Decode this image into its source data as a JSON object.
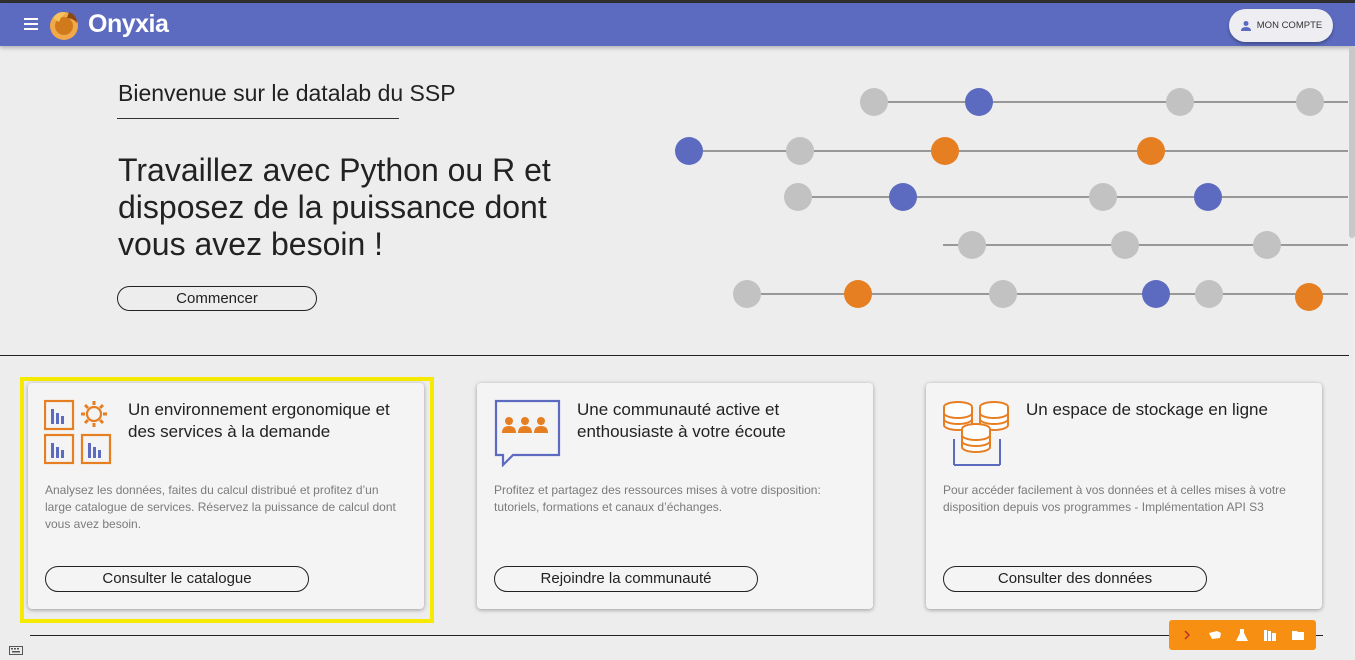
{
  "app": {
    "brand": "Onyxia",
    "account_label": "MON COMPTE"
  },
  "hero": {
    "subtitle": "Bienvenue sur le datalab du SSP",
    "title": "Travaillez avec Python ou R et disposez de la puissance dont vous avez besoin !",
    "cta": "Commencer"
  },
  "cards": [
    {
      "title": "Un environnement ergonomique et des services à la demande",
      "description": "Analysez les données, faites du calcul distribué et profitez d’un large catalogue de services. Réservez la puissance de calcul dont vous avez besoin.",
      "button": "Consulter le catalogue",
      "icon": "services-icon"
    },
    {
      "title": "Une communauté active et enthousiaste à votre écoute",
      "description": "Profitez et partagez des ressources mises à votre disposition: tutoriels, formations et canaux d’échanges.",
      "button": "Rejoindre la communauté",
      "icon": "community-icon"
    },
    {
      "title": "Un espace de stockage en ligne",
      "description": "Pour accéder facilement à vos données et à celles mises à votre disposition depuis vos programmes - Implémentation API S3",
      "button": "Consulter des données",
      "icon": "storage-icon"
    }
  ],
  "toolbar": {
    "items": [
      "chevron-right-icon",
      "tools-icon",
      "flask-icon",
      "books-icon",
      "folder-icon"
    ]
  },
  "colors": {
    "appbar": "#5c6bc0",
    "accent": "#e67e22",
    "highlight": "#f5ea00",
    "toolbar": "#f79012"
  }
}
